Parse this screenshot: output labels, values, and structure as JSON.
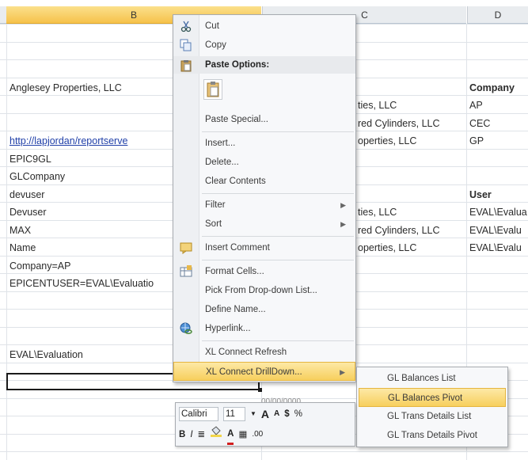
{
  "columns": [
    {
      "id": "B",
      "label": "B",
      "selected": true
    },
    {
      "id": "C",
      "label": "C",
      "selected": false
    },
    {
      "id": "D",
      "label": "D",
      "selected": false
    }
  ],
  "cells_b": [
    {
      "row": 3,
      "text": "Anglesey Properties, LLC",
      "link": false
    },
    {
      "row": 6,
      "text": "http://lapjordan/reportserve",
      "link": true
    },
    {
      "row": 7,
      "text": "EPIC9GL",
      "link": false
    },
    {
      "row": 8,
      "text": "GLCompany",
      "link": false
    },
    {
      "row": 9,
      "text": "devuser",
      "link": false
    },
    {
      "row": 10,
      "text": "Devuser",
      "link": false
    },
    {
      "row": 11,
      "text": "MAX",
      "link": false
    },
    {
      "row": 12,
      "text": "Name",
      "link": false
    },
    {
      "row": 13,
      "text": "Company=AP",
      "link": false
    },
    {
      "row": 14,
      "text": "EPICENTUSER=EVAL\\Evaluatio",
      "link": false
    },
    {
      "row": 18,
      "text": "EVAL\\Evaluation",
      "link": false
    }
  ],
  "cells_c": [
    {
      "row": 4,
      "text": "ties, LLC"
    },
    {
      "row": 5,
      "text": "red Cylinders, LLC"
    },
    {
      "row": 6,
      "text": "operties, LLC"
    },
    {
      "row": 10,
      "text": "ties, LLC"
    },
    {
      "row": 11,
      "text": "red Cylinders, LLC"
    },
    {
      "row": 12,
      "text": "operties, LLC"
    }
  ],
  "cells_d": [
    {
      "row": 3,
      "text": "Company",
      "bold": true
    },
    {
      "row": 4,
      "text": "AP",
      "bold": false
    },
    {
      "row": 5,
      "text": "CEC",
      "bold": false
    },
    {
      "row": 6,
      "text": "GP",
      "bold": false
    },
    {
      "row": 9,
      "text": "User",
      "bold": true
    },
    {
      "row": 10,
      "text": "EVAL\\Evalua",
      "bold": false
    },
    {
      "row": 11,
      "text": "EVAL\\Evalu",
      "bold": false
    },
    {
      "row": 12,
      "text": "EVAL\\Evalu",
      "bold": false
    }
  ],
  "context_menu": {
    "cut": "Cut",
    "copy": "Copy",
    "paste_options": "Paste Options:",
    "paste_special": "Paste Special...",
    "insert": "Insert...",
    "delete": "Delete...",
    "clear_contents": "Clear Contents",
    "filter": "Filter",
    "sort": "Sort",
    "insert_comment": "Insert Comment",
    "format_cells": "Format Cells...",
    "pick_list": "Pick From Drop-down List...",
    "define_name": "Define Name...",
    "hyperlink": "Hyperlink...",
    "xl_refresh": "XL Connect Refresh",
    "xl_drilldown": "XL Connect DrillDown..."
  },
  "submenu": {
    "items": [
      "GL Balances List",
      "GL Balances Pivot",
      "GL Trans Details List",
      "GL Trans Details Pivot"
    ],
    "highlighted_index": 1
  },
  "mini_toolbar": {
    "font": "Calibri",
    "size": "11",
    "grow": "A",
    "shrink": "A",
    "currency": "$",
    "percent": "%",
    "bold": "B",
    "italic": "I",
    "font_color_letter": "A",
    "decimals": ".00"
  },
  "partial_text": {
    "below_selection": "00/00/0000"
  },
  "colors": {
    "accent": "#f7cf5d",
    "link": "#1f3fa8",
    "header": "#e9ecef"
  }
}
